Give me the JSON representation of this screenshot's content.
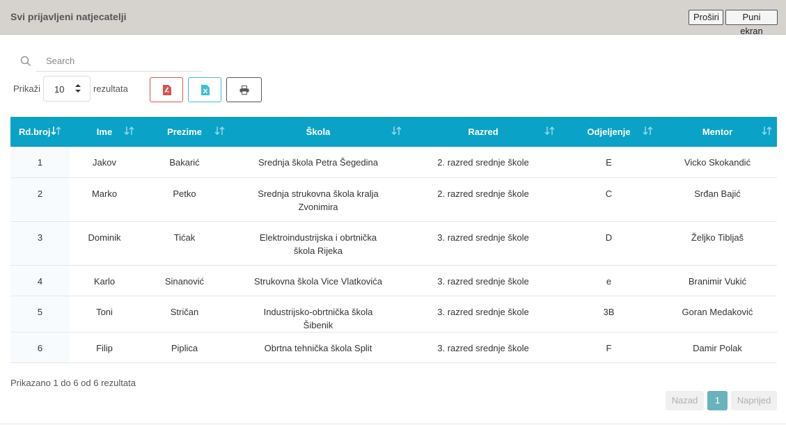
{
  "header": {
    "title": "Svi prijavljeni natjecatelji",
    "expand_label": "Proširi",
    "fullscreen_label": "Puni ekran"
  },
  "toolbar": {
    "search_placeholder": "Search",
    "show_label": "Prikaži",
    "page_size": "10",
    "results_label": "rezultata",
    "icons": [
      "pdf-icon",
      "excel-icon",
      "print-icon"
    ]
  },
  "table": {
    "columns": [
      "Rd.broj",
      "Ime",
      "Prezime",
      "Škola",
      "Razred",
      "Odjeljenje",
      "Mentor"
    ],
    "rows": [
      [
        "1",
        "Jakov",
        "Bakarić",
        "Srednja škola Petra Šegedina",
        "2. razred srednje škole",
        "E",
        "Vicko Skokandić"
      ],
      [
        "2",
        "Marko",
        "Petko",
        "Srednja strukovna škola kralja Zvonimira",
        "2. razred srednje škole",
        "C",
        "Srđan Bajić"
      ],
      [
        "3",
        "Dominik",
        "Tićak",
        "Elektroindustrijska i obrtnička škola Rijeka",
        "3. razred srednje škole",
        "D",
        "Željko Tibljaš"
      ],
      [
        "4",
        "Karlo",
        "Sinanović",
        "Strukovna škola Vice Vlatkovića",
        "3. razred srednje škole",
        "e",
        "Branimir Vukić"
      ],
      [
        "5",
        "Toni",
        "Stričan",
        "Industrijsko-obrtnička škola Šibenik",
        "3. razred srednje škole",
        "3B",
        "Goran Medaković"
      ],
      [
        "6",
        "Filip",
        "Piplica",
        "Obrtna tehnička škola Split",
        "3. razred srednje škole",
        "F",
        "Damir Polak"
      ]
    ]
  },
  "footer": {
    "info": "Prikazano 1 do 6 od 6 rezultata",
    "prev_label": "Nazad",
    "current_page": "1",
    "next_label": "Naprijed"
  },
  "colors": {
    "header_bg": "#d6d3cf",
    "table_header": "#0aa2c7",
    "pdf": "#d9534f",
    "excel": "#3cbfd0",
    "print": "#555555",
    "active_page": "#6bb3bc"
  }
}
